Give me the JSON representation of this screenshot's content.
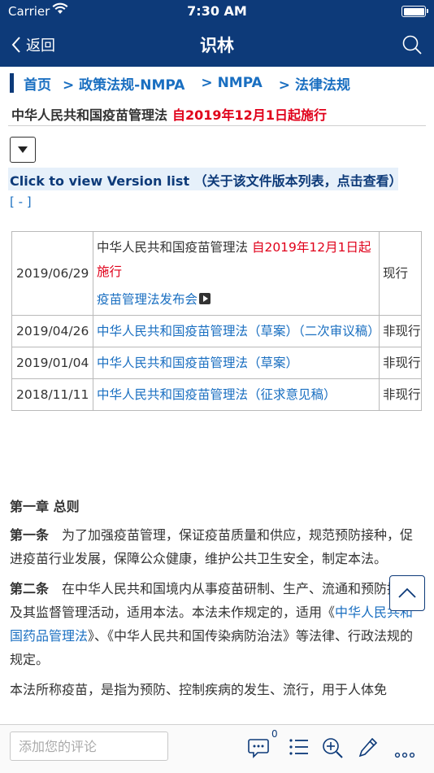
{
  "status_bar": {
    "carrier": "Carrier",
    "time": "7:30 AM",
    "battery_level": 1.0
  },
  "nav": {
    "back_label": "返回",
    "title": "识林"
  },
  "breadcrumb": {
    "home": "首页",
    "items": [
      "> 政策法规-NMPA",
      "> NMPA",
      "> 法律法规"
    ]
  },
  "document": {
    "title": "中华人民共和国疫苗管理法",
    "effective": "自2019年12月1日起施行"
  },
  "version_list": {
    "link_text": "Click to view Version list （关于该文件版本列表，点击查看）",
    "collapse_text": "[ - ]",
    "rows": [
      {
        "date": "2019/06/29",
        "title": "中华人民共和国疫苗管理法",
        "note": "自2019年12月1日起施行",
        "extra_link": "疫苗管理法发布会",
        "status": "现行"
      },
      {
        "date": "2019/04/26",
        "title": "中华人民共和国疫苗管理法（草案）（二次审议稿）",
        "status": "非现行"
      },
      {
        "date": "2019/01/04",
        "title": "中华人民共和国疫苗管理法（草案）",
        "status": "非现行"
      },
      {
        "date": "2018/11/11",
        "title": "中华人民共和国疫苗管理法（征求意见稿）",
        "status": "非现行"
      }
    ]
  },
  "body": {
    "chapter": "第一章 总则",
    "article1_label": "第一条",
    "article1_text": "为了加强疫苗管理，保证疫苗质量和供应，规范预防接种，促进疫苗行业发展，保障公众健康，维护公共卫生安全，制定本法。",
    "article2_label": "第二条",
    "article2_text_a": "在中华人民共和国境内从事疫苗研制、生产、流通和预防接种及其监督管理活动，适用本法。本法未作规定的，适用《",
    "article2_link": "中华人民共和国药品管理法",
    "article2_text_b": "》、《中华人民共和国传染病防治法》等法律、行政法规的规定。",
    "paragraph3": "本法所称疫苗，是指为预防、控制疾病的发生、流行，用于人体免"
  },
  "toolbar": {
    "comment_placeholder": "添加您的评论",
    "comment_count": "0"
  },
  "colors": {
    "header": "#0d3a79",
    "link": "#1a6fc1",
    "red": "#e0001a"
  }
}
